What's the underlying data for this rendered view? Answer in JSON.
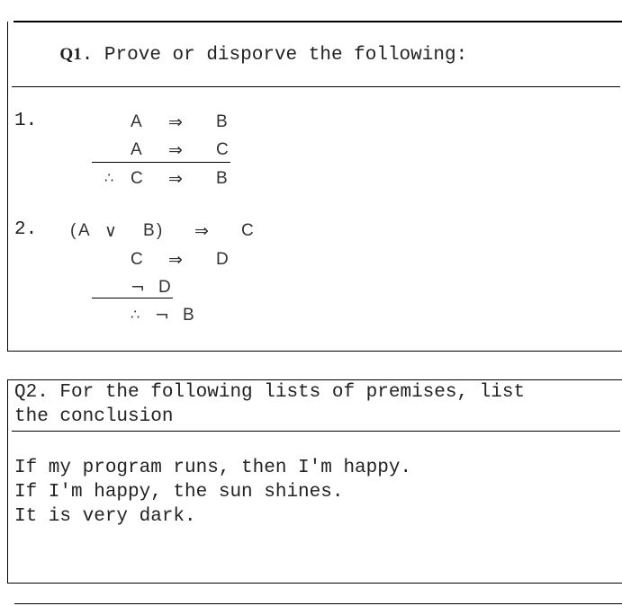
{
  "q1": {
    "label": "Q1",
    "title": ". Prove or disporve the following:",
    "problems": [
      {
        "number": "1.",
        "premises": [
          {
            "left": "A",
            "op": "⇒",
            "right": "B"
          },
          {
            "left": "A",
            "op": "⇒",
            "right": "C"
          }
        ],
        "conclusion": {
          "therefore": "∴",
          "left": "C",
          "op": "⇒",
          "right": "B"
        }
      },
      {
        "number": "2.",
        "premises": [
          {
            "open": "(",
            "a": "A",
            "or": "∨",
            "b": "B",
            "close": ")",
            "op": "⇒",
            "right": "C"
          },
          {
            "left": "C",
            "op": "⇒",
            "right": "D"
          },
          {
            "neg": "¬",
            "right": "D"
          }
        ],
        "conclusion": {
          "therefore": "∴",
          "neg": "¬",
          "right": "B"
        }
      }
    ]
  },
  "q2": {
    "title_line1": "Q2. For the following lists of premises, list",
    "title_line2": "the conclusion",
    "premises": [
      "If my program runs, then I'm happy.",
      "If I'm happy, the sun shines.",
      "It is very dark."
    ]
  }
}
